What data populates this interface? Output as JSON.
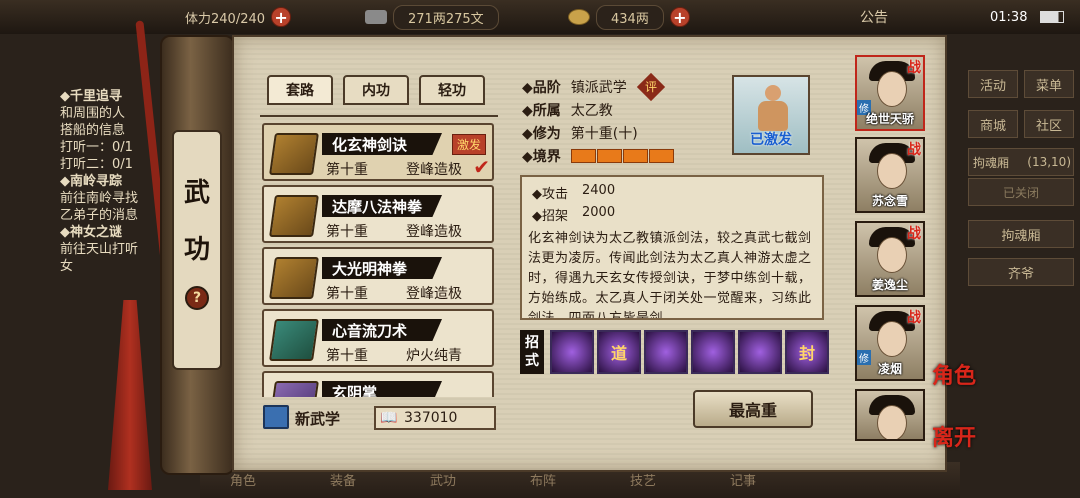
{
  "topbar": {
    "stamina": "体力240/240",
    "silver": "271两275文",
    "gold": "434两",
    "notice": "公告",
    "clock": "01:38"
  },
  "left_quests": {
    "q1_title": "◆千里追寻",
    "q1_lines": [
      "和周围的人",
      "搭船的信息",
      "打听一：0/1",
      "打听二：0/1"
    ],
    "q2_title": "◆南岭寻踪",
    "q2_lines": [
      "前往南岭寻找",
      "乙弟子的消息"
    ],
    "q3_title": "◆神女之谜",
    "q3_lines": [
      "前往天山打听",
      "女"
    ]
  },
  "right_menu": {
    "activity": "活动",
    "menu": "菜单",
    "mall": "商城",
    "community": "社区",
    "soul_cave": "拘魂厢",
    "soul_count": "(13,10)",
    "closed": "已关闭",
    "soul_btn": "拘魂厢",
    "qiye": "齐爷"
  },
  "bottom": {
    "items": [
      "角色",
      "装备",
      "武功",
      "布阵",
      "技艺",
      "记事"
    ]
  },
  "scroll": {
    "title_char1": "武",
    "title_char2": "功",
    "help": "?"
  },
  "tabs": [
    "套路",
    "内功",
    "轻功"
  ],
  "skills": [
    {
      "name": "化玄神剑诀",
      "badge": "激发",
      "level": "第十重",
      "state": "登峰造极",
      "selected": true
    },
    {
      "name": "达摩八法神拳",
      "level": "第十重",
      "state": "登峰造极"
    },
    {
      "name": "大光明神拳",
      "level": "第十重",
      "state": "登峰造极"
    },
    {
      "name": "心音流刀术",
      "level": "第十重",
      "state": "炉火纯青"
    },
    {
      "name": "玄阴掌"
    }
  ],
  "new_skill": "新武学",
  "points": "337010",
  "detail": {
    "grade_label": "品阶",
    "grade": "镇派武学",
    "rate": "评",
    "sect_label": "所属",
    "sect": "太乙教",
    "level_label": "修为",
    "level": "第十重(十)",
    "realm_label": "境界",
    "realm_segments": 4,
    "activated": "已激发",
    "atk_label": "◆攻击",
    "atk": "2400",
    "def_label": "◆招架",
    "def": "2000",
    "description": "化玄神剑诀为太乙教镇派剑法，较之真武七截剑法更为凌厉。传闻此剑法为太乙真人神游太虚之时，得遇九天玄女传授剑诀，于梦中练剑十载，方始练成。太乙真人于闭关处一觉醒来，习练此剑法，四面八方皆是剑",
    "moves_label": [
      "招",
      "式"
    ],
    "moves": [
      "",
      "道",
      "",
      "",
      "",
      "封"
    ],
    "max_button": "最高重"
  },
  "heroes": [
    {
      "name": "绝世天骄",
      "fight": "战",
      "xiu": "修",
      "selected": true
    },
    {
      "name": "苏念雪",
      "fight": "战"
    },
    {
      "name": "姜逸尘",
      "fight": "战"
    },
    {
      "name": "凌烟",
      "fight": "战",
      "xiu": "修"
    },
    {
      "name": ""
    }
  ],
  "side": {
    "role": "角色",
    "leave": "离开"
  }
}
